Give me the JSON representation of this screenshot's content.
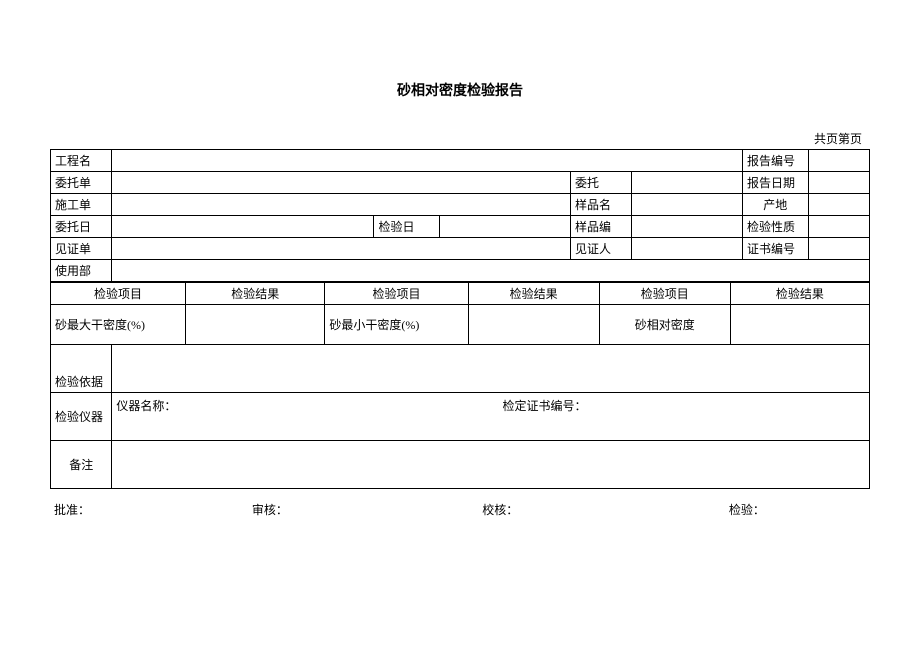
{
  "title": "砂相对密度检验报告",
  "page_indicator": "共页第页",
  "labels": {
    "project_name": "工程名",
    "report_no": "报告编号",
    "entrust_unit": "委托单",
    "entrust": "委托",
    "report_date": "报告日期",
    "construction_unit": "施工单",
    "sample_name": "样品名",
    "origin": "产地",
    "entrust_date": "委托日",
    "inspect_date": "检验日",
    "sample_no": "样品编",
    "inspect_nature": "检验性质",
    "witness_unit": "见证单",
    "witness_person": "见证人",
    "cert_no": "证书编号",
    "use_part": "使用部",
    "inspect_item": "检验项目",
    "inspect_result": "检验结果",
    "max_dry_density": "砂最大干密度(%)",
    "min_dry_density": "砂最小干密度(%)",
    "relative_density": "砂相对密度",
    "inspect_basis": "检验依据",
    "inspect_instrument": "检验仪器",
    "instrument_name": "仪器名称：",
    "calib_cert_no": "检定证书编号：",
    "remark": "备注"
  },
  "footer": {
    "approve": "批准：",
    "review": "审核：",
    "check": "校核：",
    "inspect": "检验："
  },
  "chart_data": {
    "type": "table",
    "title": "砂相对密度检验报告",
    "header_fields": [
      {
        "label": "工程名",
        "value": "",
        "label2": "报告编号",
        "value2": ""
      },
      {
        "label": "委托单",
        "value": "",
        "label2": "委托",
        "value2": "",
        "label3": "报告日期",
        "value3": ""
      },
      {
        "label": "施工单",
        "value": "",
        "label2": "样品名",
        "value2": "",
        "label3": "产地",
        "value3": ""
      },
      {
        "label": "委托日",
        "value": "",
        "label2": "检验日",
        "value2": "",
        "label3": "样品编",
        "value3": "",
        "label4": "检验性质",
        "value4": ""
      },
      {
        "label": "见证单",
        "value": "",
        "label2": "见证人",
        "value2": "",
        "label3": "证书编号",
        "value3": ""
      },
      {
        "label": "使用部",
        "value": ""
      }
    ],
    "result_columns": [
      "检验项目",
      "检验结果",
      "检验项目",
      "检验结果",
      "检验项目",
      "检验结果"
    ],
    "result_rows": [
      {
        "item1": "砂最大干密度(%)",
        "result1": "",
        "item2": "砂最小干密度(%)",
        "result2": "",
        "item3": "砂相对密度",
        "result3": ""
      }
    ],
    "lower_rows": [
      {
        "label": "检验依据",
        "value": ""
      },
      {
        "label": "检验仪器",
        "instrument_name": "",
        "calib_cert_no": ""
      },
      {
        "label": "备注",
        "value": ""
      }
    ],
    "signatures": [
      "批准：",
      "审核：",
      "校核：",
      "检验："
    ]
  }
}
